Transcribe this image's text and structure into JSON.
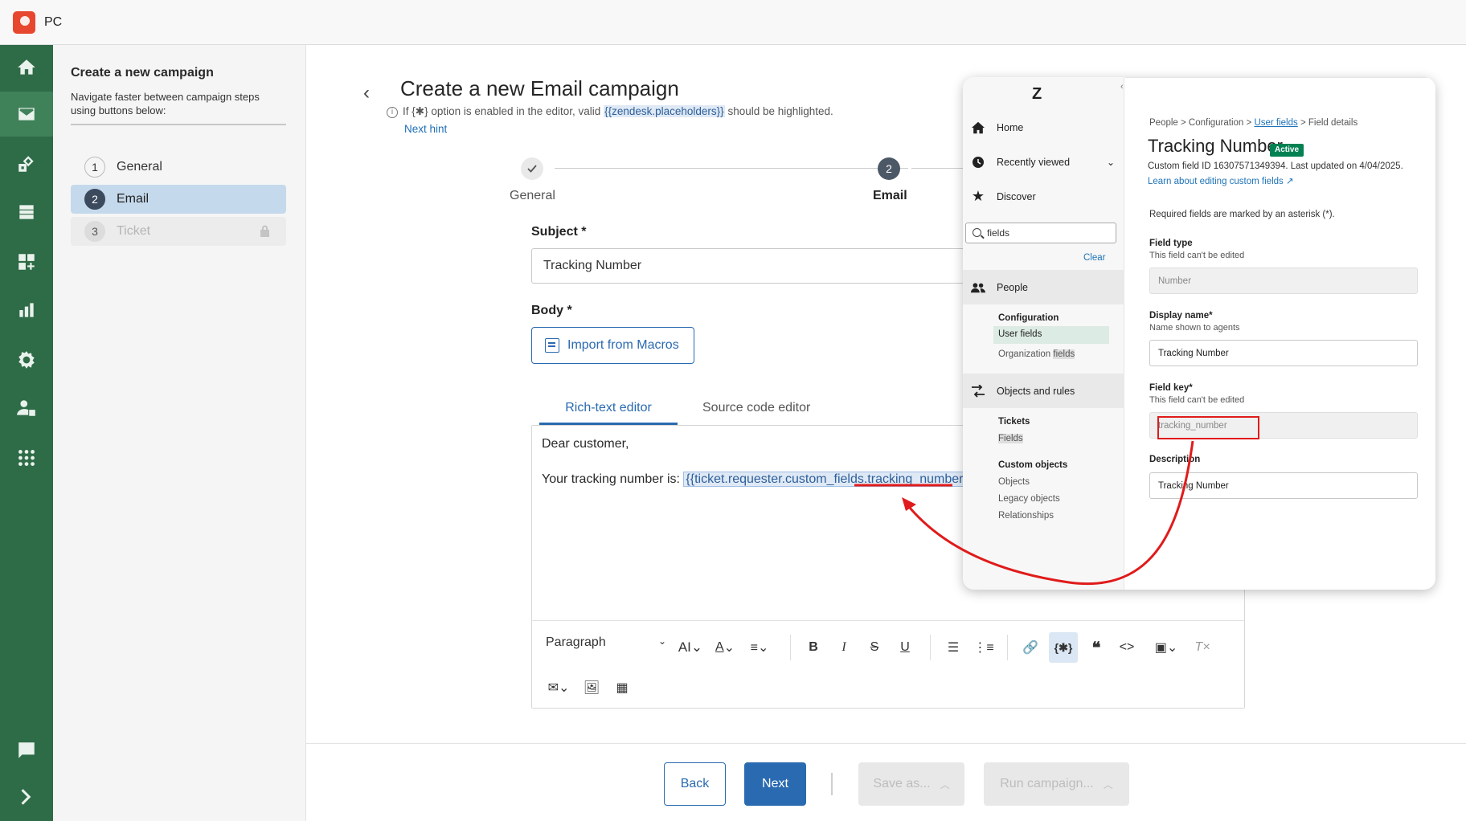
{
  "app": {
    "title": "PC"
  },
  "rail": {
    "items": [
      "home",
      "email",
      "shapes",
      "database",
      "dashboard-add",
      "analytics",
      "settings",
      "user-lock",
      "apps",
      "chat",
      "expand"
    ]
  },
  "steps_panel": {
    "title": "Create a new campaign",
    "description": "Navigate faster between campaign steps using buttons below:",
    "steps": [
      {
        "num": "1",
        "label": "General"
      },
      {
        "num": "2",
        "label": "Email"
      },
      {
        "num": "3",
        "label": "Ticket"
      }
    ]
  },
  "main": {
    "title": "Create a new Email campaign",
    "hint_pre": "If",
    "hint_glyph": "{✱}",
    "hint_mid": "option is enabled in the editor, valid",
    "hint_placeholder": "{{zendesk.placeholders}}",
    "hint_post": "should be highlighted.",
    "next_hint": "Next hint",
    "stepper": {
      "step1_label": "General",
      "step2_num": "2",
      "step2_label": "Email"
    },
    "subject_label": "Subject *",
    "subject_value": "Tracking Number",
    "body_label": "Body *",
    "import_button": "Import from Macros",
    "tabs": {
      "rich": "Rich-text editor",
      "source": "Source code editor"
    },
    "editor": {
      "line1": "Dear customer,",
      "line2_pre": "Your tracking number is:",
      "line2_placeholder": "{{ticket.requester.custom_fields.tracking_number}}"
    },
    "toolbar": {
      "paragraph": "Paragraph"
    }
  },
  "footer": {
    "back": "Back",
    "next": "Next",
    "save": "Save as...",
    "run": "Run campaign..."
  },
  "zendesk": {
    "logo": "Z",
    "nav": {
      "home": "Home",
      "recent": "Recently viewed",
      "discover": "Discover",
      "search_value": "fields",
      "clear": "Clear",
      "people": "People",
      "configuration": "Configuration",
      "user_fields_pre": "User ",
      "user_fields_hl": "fields",
      "org_fields_pre": "Organization ",
      "org_fields_hl": "fields",
      "objects_rules": "Objects and rules",
      "tickets": "Tickets",
      "tickets_fields": "Fields",
      "custom_objects": "Custom objects",
      "objects": "Objects",
      "legacy_objects": "Legacy objects",
      "relationships": "Relationships"
    },
    "detail": {
      "crumb1": "People",
      "crumb2": "Configuration",
      "crumb3": "User fields",
      "crumb4": "Field details",
      "title": "Tracking Number",
      "badge": "Active",
      "meta": "Custom field ID 16307571349394. Last updated on 4/04/2025.",
      "learn": "Learn about editing custom fields",
      "required_note": "Required fields are marked by an asterisk (*).",
      "field_type_label": "Field type",
      "field_type_help": "This field can't be edited",
      "field_type_value": "Number",
      "display_name_label": "Display name*",
      "display_name_help": "Name shown to agents",
      "display_name_value": "Tracking Number",
      "field_key_label": "Field key*",
      "field_key_help": "This field can't be edited",
      "field_key_value": "tracking_number",
      "description_label": "Description",
      "description_value": "Tracking Number"
    }
  },
  "colors": {
    "rail": "#2e6b47",
    "accent": "#2a6ab0",
    "annotation": "#e01b1b",
    "zendesk_badge": "#038153"
  }
}
